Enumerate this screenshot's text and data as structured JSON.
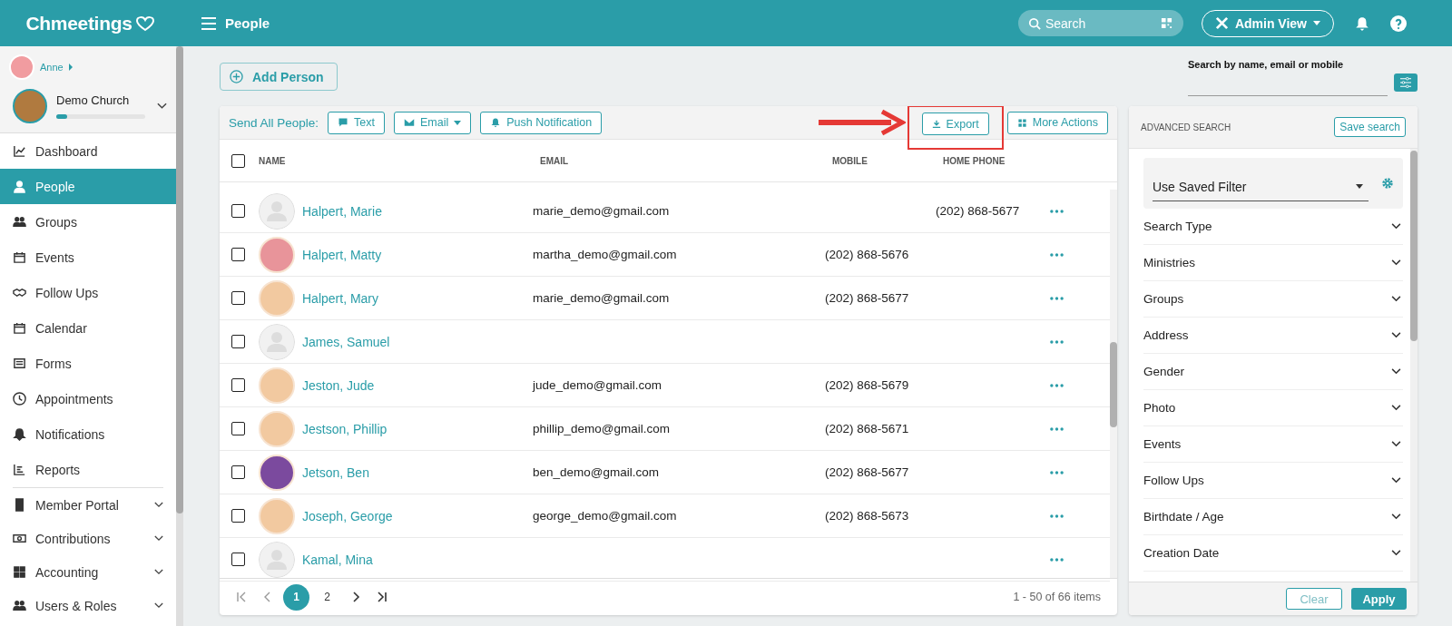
{
  "header": {
    "logo": "Chmeetings",
    "page_title": "People",
    "search": {
      "placeholder": "Search"
    },
    "view_button": "Admin View"
  },
  "sidebar": {
    "user": "Anne",
    "church": {
      "name": "Demo Church",
      "level": 0.12
    },
    "items": [
      {
        "label": "Dashboard",
        "selected": false,
        "kind": "link"
      },
      {
        "label": "People",
        "selected": true,
        "kind": "link"
      },
      {
        "label": "Groups",
        "selected": false,
        "kind": "link"
      },
      {
        "label": "Events",
        "selected": false,
        "kind": "link"
      },
      {
        "label": "Follow Ups",
        "selected": false,
        "kind": "link"
      },
      {
        "label": "Calendar",
        "selected": false,
        "kind": "link"
      },
      {
        "label": "Forms",
        "selected": false,
        "kind": "link"
      },
      {
        "label": "Appointments",
        "selected": false,
        "kind": "link"
      },
      {
        "label": "Notifications",
        "selected": false,
        "kind": "link"
      },
      {
        "label": "Reports",
        "selected": false,
        "kind": "link"
      },
      {
        "label": "Member Portal",
        "selected": false,
        "kind": "group"
      },
      {
        "label": "Contributions",
        "selected": false,
        "kind": "group"
      },
      {
        "label": "Accounting",
        "selected": false,
        "kind": "group"
      },
      {
        "label": "Users & Roles",
        "selected": false,
        "kind": "group"
      }
    ]
  },
  "add_button": "Add Person",
  "search_by": {
    "label": "Search by name, email or mobile"
  },
  "toolbar": {
    "label": "Send All People:",
    "actions": [
      {
        "label": "Text",
        "dropdown": false
      },
      {
        "label": "Email",
        "dropdown": true
      },
      {
        "label": "Push Notification",
        "dropdown": false
      }
    ],
    "export": "Export",
    "more": "More Actions"
  },
  "table": {
    "select_all_checked": false,
    "columns": [
      "NAME",
      "EMAIL",
      "MOBILE",
      "HOME PHONE"
    ],
    "rows": [
      {
        "name": "Halpert, Marie",
        "email": "marie_demo@gmail.com",
        "mobile": "",
        "home": "(202) 868-5677",
        "kind": "blank",
        "checked": false
      },
      {
        "name": "Halpert, Matty",
        "email": "martha_demo@gmail.com",
        "mobile": "(202) 868-5676",
        "home": "",
        "kind": "photo",
        "color": "#e8949a",
        "checked": false
      },
      {
        "name": "Halpert, Mary",
        "email": "marie_demo@gmail.com",
        "mobile": "(202) 868-5677",
        "home": "",
        "kind": "photo",
        "color": "#f2c9a0",
        "checked": false
      },
      {
        "name": "James, Samuel",
        "email": "",
        "mobile": "",
        "home": "",
        "kind": "blank",
        "checked": false
      },
      {
        "name": "Jeston, Jude",
        "email": "jude_demo@gmail.com",
        "mobile": "(202) 868-5679",
        "home": "",
        "kind": "photo",
        "color": "#f2c9a0",
        "checked": false
      },
      {
        "name": "Jestson, Phillip",
        "email": "phillip_demo@gmail.com",
        "mobile": "(202) 868-5671",
        "home": "",
        "kind": "photo",
        "color": "#f2c9a0",
        "checked": false
      },
      {
        "name": "Jetson, Ben",
        "email": "ben_demo@gmail.com",
        "mobile": "(202) 868-5677",
        "home": "",
        "kind": "photo",
        "color": "#7b4a9e",
        "checked": false
      },
      {
        "name": "Joseph, George",
        "email": "george_demo@gmail.com",
        "mobile": "(202) 868-5673",
        "home": "",
        "kind": "photo",
        "color": "#f2c9a0",
        "checked": false
      },
      {
        "name": "Kamal, Mina",
        "email": "",
        "mobile": "",
        "home": "",
        "kind": "blank",
        "checked": false
      }
    ]
  },
  "pagination": {
    "pages": [
      {
        "label": "1",
        "selected": true
      },
      {
        "label": "2",
        "selected": false
      }
    ],
    "summary": "1 - 50 of 66 items"
  },
  "advanced_search": {
    "title": "ADVANCED SEARCH",
    "save": "Save search",
    "saved_filter": "Use Saved Filter",
    "filters": [
      "Search Type",
      "Ministries",
      "Groups",
      "Address",
      "Gender",
      "Photo",
      "Events",
      "Follow Ups",
      "Birthdate / Age",
      "Creation Date"
    ],
    "clear": "Clear",
    "apply": "Apply"
  }
}
